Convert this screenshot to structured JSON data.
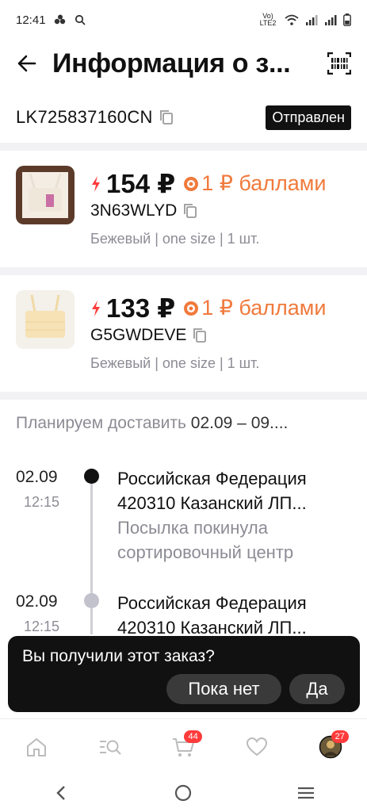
{
  "status_bar": {
    "time": "12:41",
    "icons": [
      "dots-icon",
      "search-icon",
      "volte-icon",
      "wifi-icon",
      "signal-icon",
      "signal-icon",
      "battery-icon"
    ],
    "volte_label": "Vo) LTE2"
  },
  "header": {
    "title": "Информация о з...",
    "back_icon": "arrow-left-icon",
    "action_icon": "barcode-icon"
  },
  "order": {
    "tracking_number": "LK725837160CN",
    "status": "Отправлен"
  },
  "products": [
    {
      "price": "154 ₽",
      "points": "1 ₽ баллами",
      "sku": "3N63WLYD",
      "variant": "Бежевый | one size | 1 шт.",
      "thumb_color": "#f3ede4"
    },
    {
      "price": "133 ₽",
      "points": "1 ₽ баллами",
      "sku": "G5GWDEVE",
      "variant": "Бежевый | one size | 1 шт.",
      "thumb_color": "#f6e9c8"
    }
  ],
  "delivery": {
    "label": "Планируем доставить",
    "dates": "02.09 – 09...."
  },
  "timeline": [
    {
      "date": "02.09",
      "time": "12:15",
      "line1": "Российская Федерация",
      "line2": "420310 Казанский ЛП...",
      "line3": "Посылка покинула",
      "line4": "сортировочный центр",
      "active": true
    },
    {
      "date": "02.09",
      "time": "12:15",
      "line1": "Российская Федерация",
      "line2": "420310 Казанский ЛП...",
      "active": false
    }
  ],
  "toast": {
    "question": "Вы получили этот заказ?",
    "no_label": "Пока нет",
    "yes_label": "Да"
  },
  "bottom_nav": {
    "items": [
      "home-icon",
      "catalog-search-icon",
      "cart-icon",
      "favorites-icon",
      "profile-avatar"
    ],
    "cart_badge": "44",
    "profile_badge": "27"
  },
  "colors": {
    "accent_orange": "#f07a3c",
    "bolt_red": "#ff3b3b",
    "badge_red": "#ff3b3b",
    "muted": "#8c8c95"
  }
}
